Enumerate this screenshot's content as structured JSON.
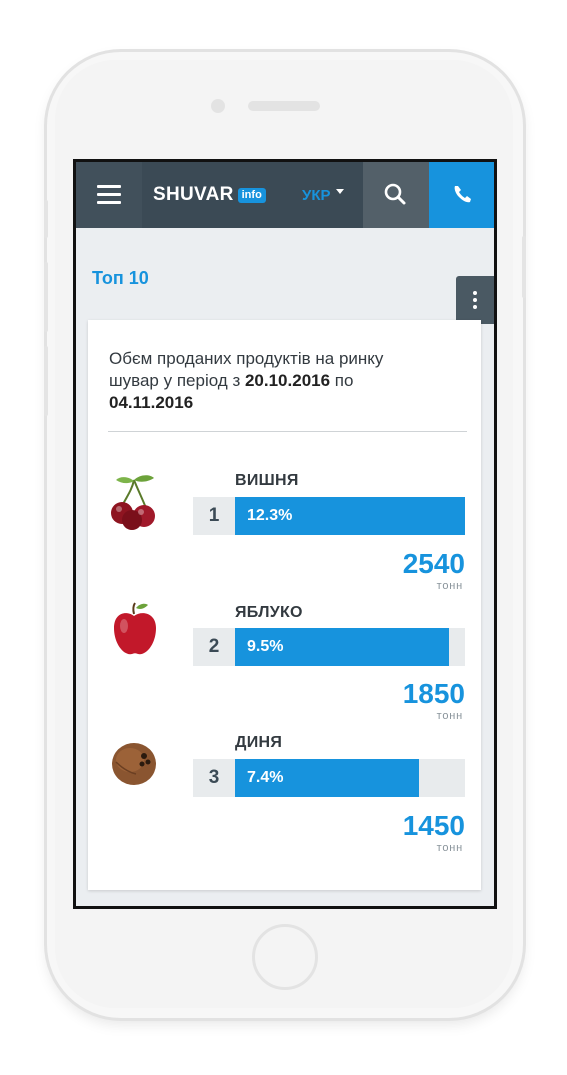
{
  "header": {
    "logo_text": "SHUVAR",
    "logo_badge": "info",
    "language": "УКР"
  },
  "section_title": "Топ 10",
  "card": {
    "description_prefix": "Обєм проданих продуктів на ринку шувар у період з ",
    "date_from": "20.10.2016",
    "description_middle": " по ",
    "date_to": "04.11.2016"
  },
  "items": [
    {
      "rank": "1",
      "name": "ВИШНЯ",
      "percent_label": "12.3%",
      "bar_fill": 1.0,
      "amount": "2540",
      "unit": "тонн",
      "icon": "cherry-icon"
    },
    {
      "rank": "2",
      "name": "ЯБЛУКО",
      "percent_label": "9.5%",
      "bar_fill": 0.93,
      "amount": "1850",
      "unit": "тонн",
      "icon": "apple-icon"
    },
    {
      "rank": "3",
      "name": "ДИНЯ",
      "percent_label": "7.4%",
      "bar_fill": 0.8,
      "amount": "1450",
      "unit": "тонн",
      "icon": "melon-icon"
    }
  ],
  "colors": {
    "accent": "#1793dd",
    "header_bg": "#3b4a55",
    "background": "#ebeef1"
  }
}
